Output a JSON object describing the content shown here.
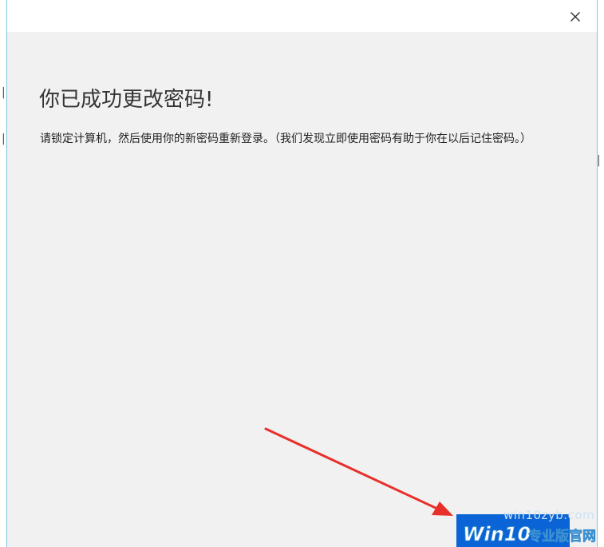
{
  "dialog": {
    "heading": "你已成功更改密码!",
    "message": "请锁定计算机，然后使用你的新密码重新登录。（我们发现立即使用密码有助于你在以后记住密码。）",
    "close_icon": "close-icon",
    "finish_label": ""
  },
  "watermark": {
    "url": "win10zyb.com",
    "logo_brand": "Win10",
    "logo_suffix": "专业版官网"
  },
  "colors": {
    "dialog_bg": "#f1f1f1",
    "accent_border": "#7fc6dd",
    "button_blue": "#0a64d6",
    "arrow_red": "#e8302a"
  }
}
